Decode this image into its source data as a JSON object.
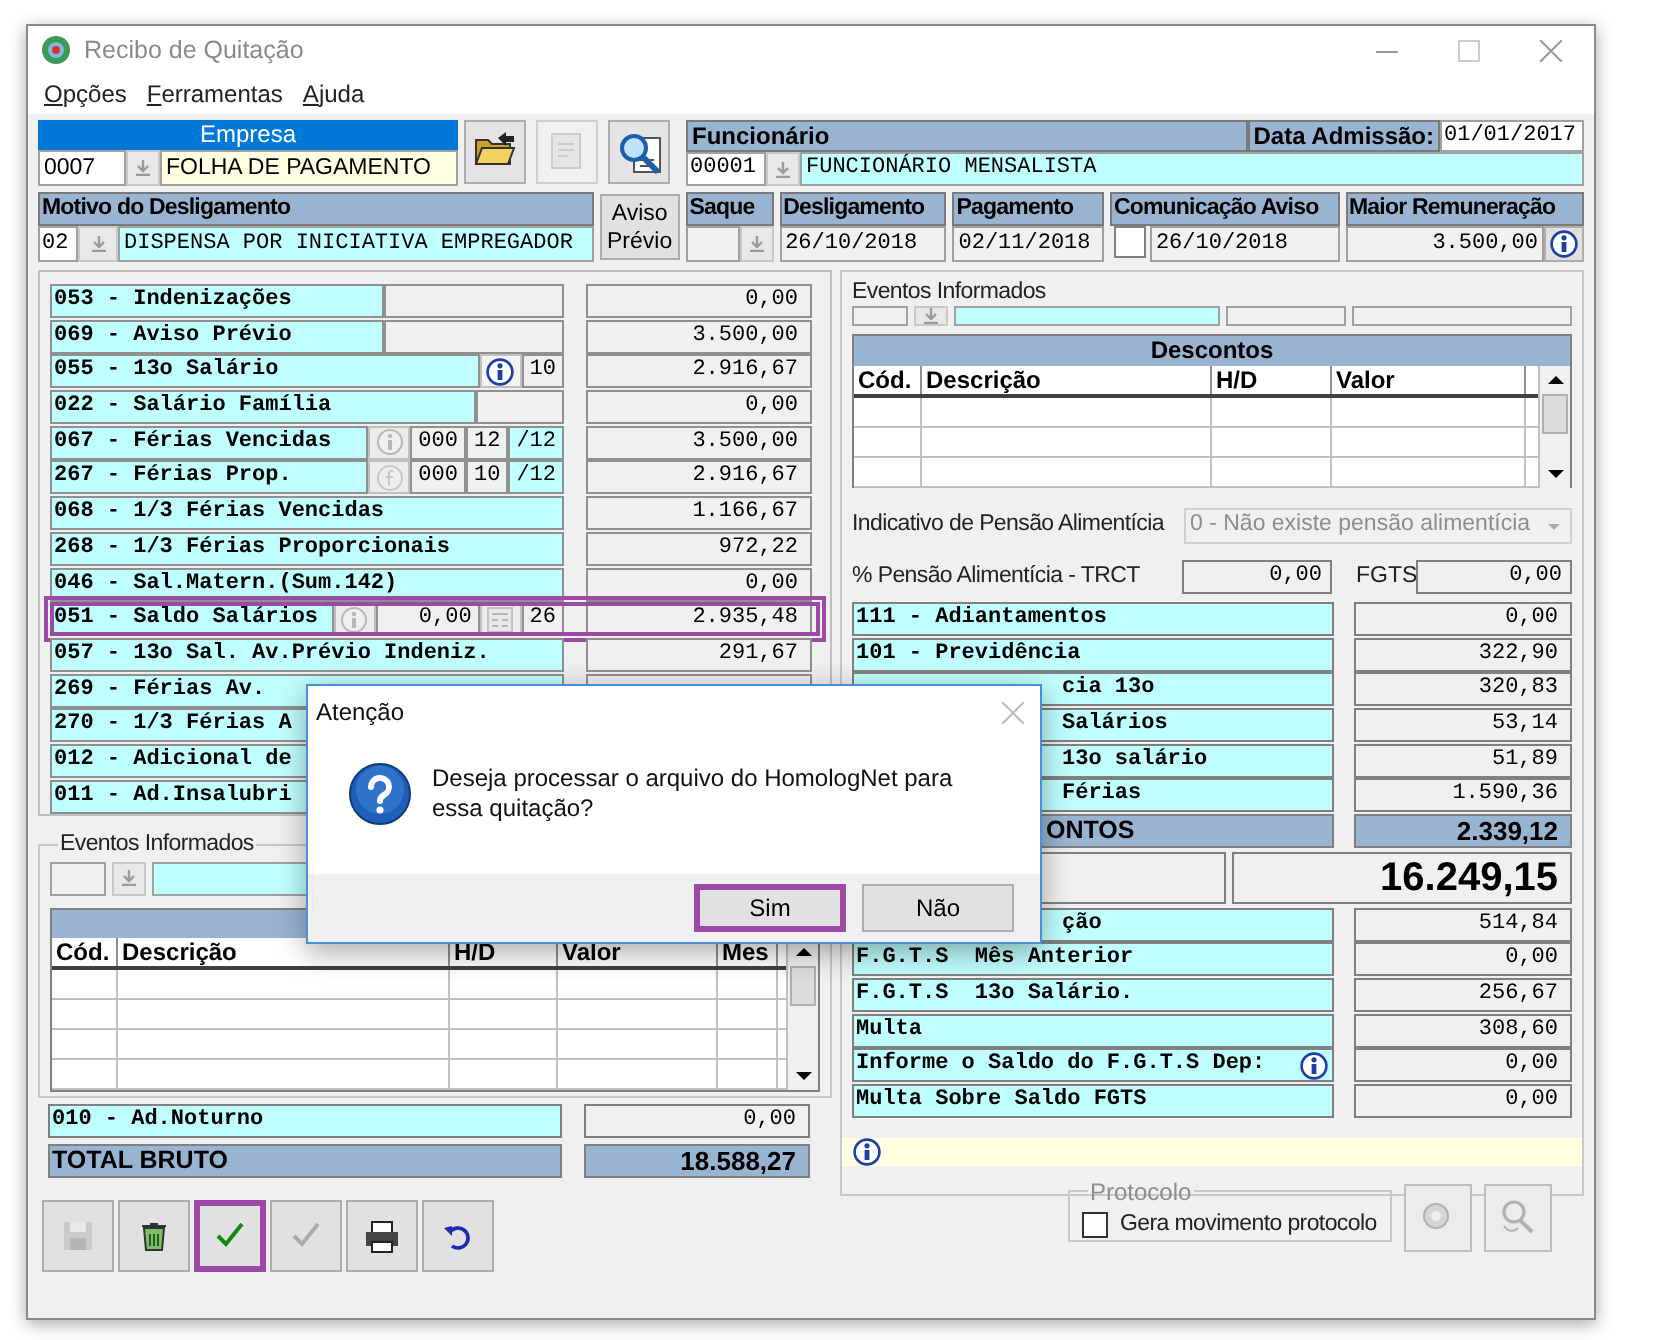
{
  "window": {
    "title": "Recibo de Quitação"
  },
  "menu": [
    {
      "label": "Opções"
    },
    {
      "label": "Ferramentas"
    },
    {
      "label": "Ajuda"
    }
  ],
  "empresa": {
    "title": "Empresa",
    "code": "0007",
    "name": "FOLHA DE PAGAMENTO"
  },
  "top_buttons": [
    {
      "kind": "folder",
      "disabled": false
    },
    {
      "kind": "document",
      "disabled": true
    },
    {
      "kind": "search",
      "disabled": false
    }
  ],
  "funcionario": {
    "title": "Funcionário",
    "code": "00001",
    "name": "FUNCIONÁRIO MENSALISTA",
    "admission_label": "Data Admissão:",
    "admission_date": "01/01/2017"
  },
  "motivo": {
    "title": "Motivo do Desligamento",
    "code": "02",
    "description": "DISPENSA POR INICIATIVA EMPREGADOR"
  },
  "aviso_previo_button": "Aviso Prévio",
  "saque": {
    "title": "Saque"
  },
  "dates": [
    {
      "title": "Desligamento",
      "value": "26/10/2018"
    },
    {
      "title": "Pagamento",
      "value": "02/11/2018"
    }
  ],
  "comunicacao": {
    "title": "Comunicação Aviso",
    "value": "26/10/2018",
    "checked": false
  },
  "maior_remuneracao": {
    "title": "Maior Remuneração",
    "value": "3.500,00"
  },
  "proventos": [
    {
      "label": "053 - Indenizações",
      "parts": [
        {
          "kind": "blank"
        }
      ],
      "value": "0,00",
      "highlighted": false
    },
    {
      "label": "069 - Aviso Prévio",
      "parts": [
        {
          "kind": "blank"
        }
      ],
      "value": "3.500,00",
      "highlighted": false
    },
    {
      "label": "055 - 13o Salário",
      "parts": [
        {
          "kind": "info",
          "disabled": false
        },
        {
          "kind": "field",
          "text": "10"
        }
      ],
      "value": "2.916,67",
      "highlighted": false
    },
    {
      "label": "022 - Salário Família",
      "parts": [
        {
          "kind": "blank_small"
        }
      ],
      "value": "0,00",
      "highlighted": false
    },
    {
      "label": "067 - Férias Vencidas",
      "parts": [
        {
          "kind": "info",
          "disabled": true
        },
        {
          "kind": "field",
          "text": "000"
        },
        {
          "kind": "field",
          "text": "12"
        },
        {
          "kind": "suffix",
          "text": "/12"
        }
      ],
      "value": "3.500,00",
      "highlighted": false
    },
    {
      "label": "267 - Férias Prop.",
      "parts": [
        {
          "kind": "formula",
          "disabled": true
        },
        {
          "kind": "field",
          "text": "000"
        },
        {
          "kind": "field",
          "text": "10"
        },
        {
          "kind": "suffix",
          "text": "/12"
        }
      ],
      "value": "2.916,67",
      "highlighted": false
    },
    {
      "label": "068 - 1/3 Férias Vencidas",
      "value": "1.166,67",
      "highlighted": false
    },
    {
      "label": "268 - 1/3 Férias Proporcionais",
      "value": "972,22",
      "highlighted": false
    },
    {
      "label": "046 - Sal.Matern.(Sum.142)",
      "value": "0,00",
      "highlighted": false
    },
    {
      "label": "051 - Saldo Salários",
      "parts": [
        {
          "kind": "info",
          "disabled": true
        },
        {
          "kind": "amount",
          "text": "0,00"
        },
        {
          "kind": "calc",
          "disabled": true
        },
        {
          "kind": "field",
          "text": "26"
        }
      ],
      "value": "2.935,48",
      "highlighted": true
    },
    {
      "label": "057 - 13o Sal. Av.Prévio Indeniz.",
      "value": "291,67",
      "highlighted": false
    },
    {
      "label": "269 - Férias  Av.",
      "highlighted": false
    },
    {
      "label": "270 - 1/3 Férias A",
      "highlighted": false
    },
    {
      "label": "012 - Adicional de",
      "highlighted": false
    },
    {
      "label": "011 - Ad.Insalubri",
      "highlighted": false
    }
  ],
  "eventos_left": {
    "title": "Eventos Informados",
    "columns": [
      "Cód.",
      "Descrição",
      "H/D",
      "Valor",
      "Mes"
    ]
  },
  "proventos_footer": [
    {
      "kind": "row",
      "label": "010 - Ad.Noturno",
      "value": "0,00"
    },
    {
      "kind": "total",
      "label": "TOTAL BRUTO",
      "value": "18.588,27"
    }
  ],
  "bottom_buttons": [
    {
      "kind": "save",
      "disabled": true,
      "highlighted": false
    },
    {
      "kind": "recycle",
      "disabled": false,
      "highlighted": false
    },
    {
      "kind": "check",
      "disabled": false,
      "highlighted": true
    },
    {
      "kind": "check",
      "disabled": true,
      "highlighted": false
    },
    {
      "kind": "print",
      "disabled": false,
      "highlighted": false
    },
    {
      "kind": "undo",
      "disabled": false,
      "highlighted": false
    }
  ],
  "eventos_right": {
    "title": "Eventos Informados"
  },
  "descontos_table": {
    "title": "Descontos",
    "columns": [
      "Cód.",
      "Descrição",
      "H/D",
      "Valor"
    ]
  },
  "pensao": {
    "label": "Indicativo de Pensão Alimentícia",
    "value": "0 - Não existe pensão alimentícia",
    "disabled": true
  },
  "pensao_trct": {
    "label": "% Pensão Alimentícia - TRCT",
    "value": "0,00"
  },
  "fgts": {
    "label": "FGTS",
    "value": "0,00"
  },
  "descontos": [
    {
      "kind": "row",
      "label": "111 - Adiantamentos",
      "value": "0,00"
    },
    {
      "kind": "row",
      "label": "101 - Previdência",
      "value": "322,90"
    },
    {
      "kind": "covered",
      "label": "cia 13o",
      "value": "320,83"
    },
    {
      "kind": "covered",
      "label": "Salários",
      "value": "53,14"
    },
    {
      "kind": "covered",
      "label": "13o salário",
      "value": "51,89"
    },
    {
      "kind": "covered",
      "label": "Férias",
      "value": "1.590,36"
    },
    {
      "kind": "total",
      "label": "ONTOS",
      "value": "2.339,12"
    },
    {
      "kind": "net",
      "value": "16.249,15"
    },
    {
      "kind": "covered",
      "label": "ção",
      "value": "514,84"
    },
    {
      "kind": "row",
      "label": "F.G.T.S  Mês Anterior",
      "value": "0,00"
    },
    {
      "kind": "row",
      "label": "F.G.T.S  13o Salário.",
      "value": "256,67"
    },
    {
      "kind": "row",
      "label": "Multa",
      "value": "308,60"
    },
    {
      "kind": "info_row",
      "label": "Informe o Saldo do F.G.T.S Dep:",
      "value": "0,00"
    },
    {
      "kind": "row",
      "label": "Multa Sobre Saldo FGTS",
      "value": "0,00"
    }
  ],
  "protocolo": {
    "title": "Protocolo",
    "label": "Gera movimento protocolo",
    "checked": false
  },
  "right_buttons": [
    {
      "kind": "gear",
      "disabled": true
    },
    {
      "kind": "magnifier",
      "disabled": true
    }
  ],
  "dialog": {
    "title": "Atenção",
    "message": "Deseja processar o arquivo do HomologNet para essa quitação?",
    "buttons": [
      {
        "label": "Sim",
        "highlighted": true
      },
      {
        "label": "Não",
        "highlighted": false
      }
    ]
  }
}
